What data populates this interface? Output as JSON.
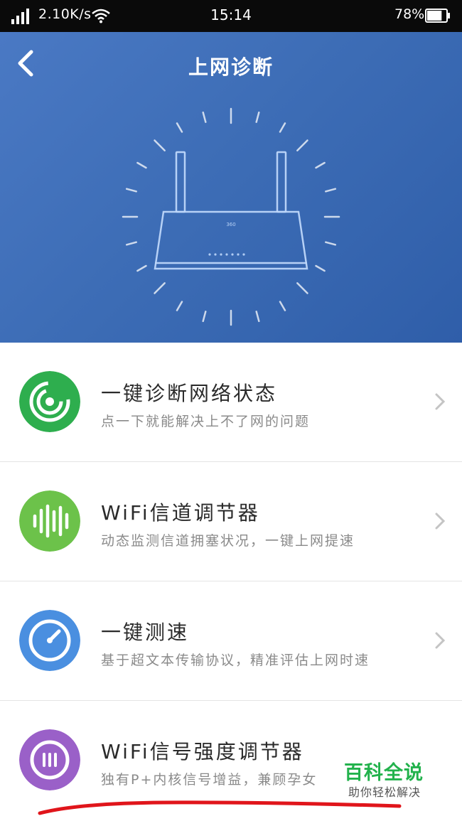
{
  "status_bar": {
    "speed": "2.10K/s",
    "time": "15:14",
    "battery_percent": "78%",
    "battery_level": 0.78,
    "icons": [
      "signal-icon",
      "wifi-icon",
      "battery-icon"
    ]
  },
  "header": {
    "back_icon": "chevron-left-icon",
    "title": "上网诊断",
    "router_brand": "360"
  },
  "items": [
    {
      "title": "一键诊断网络状态",
      "subtitle": "点一下就能解决上不了网的问题",
      "icon": "radar-icon",
      "color": "#2eae4e"
    },
    {
      "title": "WiFi信道调节器",
      "subtitle": "动态监测信道拥塞状况，一键上网提速",
      "icon": "signal-bars-icon",
      "color": "#6cc24a"
    },
    {
      "title": "一键测速",
      "subtitle": "基于超文本传输协议，精准评估上网时速",
      "icon": "speedometer-icon",
      "color": "#4a8fe0"
    },
    {
      "title": "WiFi信号强度调节器",
      "subtitle": "独有P+内核信号增益，兼顾孕女",
      "icon": "signal-strength-icon",
      "color": "#9a60c8"
    }
  ],
  "watermark": {
    "title": "百科全说",
    "subtitle": "助你轻松解决"
  },
  "colors": {
    "header_bg": "#3d6db6",
    "title_text": "#222222",
    "subtitle_text": "#8a8a8a",
    "annotation": "#e0151b"
  }
}
